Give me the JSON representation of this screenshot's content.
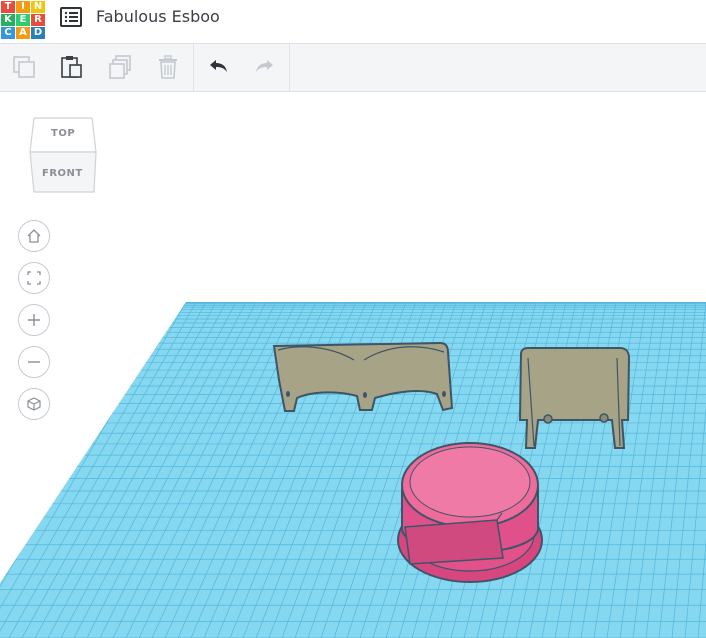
{
  "app": {
    "logo_letters": [
      "T",
      "I",
      "N",
      "K",
      "E",
      "R",
      "C",
      "A",
      "D"
    ],
    "logo_colors": [
      "#e74c3c",
      "#f39c12",
      "#f1c40f",
      "#27ae60",
      "#2ecc71",
      "#e74c3c",
      "#3498db",
      "#f39c12",
      "#2980b9"
    ],
    "document_title": "Fabulous Esboo",
    "menu_icon": "list-icon"
  },
  "toolbar": {
    "items": [
      {
        "name": "copy-icon",
        "enabled": false
      },
      {
        "name": "paste-icon",
        "enabled": true
      },
      {
        "name": "duplicate-icon",
        "enabled": false
      },
      {
        "name": "delete-icon",
        "enabled": false
      },
      {
        "name": "undo-icon",
        "enabled": true
      },
      {
        "name": "redo-icon",
        "enabled": false
      }
    ]
  },
  "viewcube": {
    "top_label": "TOP",
    "front_label": "FRONT"
  },
  "view_controls": [
    "home-icon",
    "fit-view-icon",
    "zoom-in-icon",
    "zoom-out-icon",
    "perspective-icon"
  ],
  "colors": {
    "grid": "#7fd3ee",
    "grid_line": "#4fb3d6",
    "bracket": "#a6a387",
    "cylinder": "#e8558c",
    "outline": "#3d5567"
  }
}
